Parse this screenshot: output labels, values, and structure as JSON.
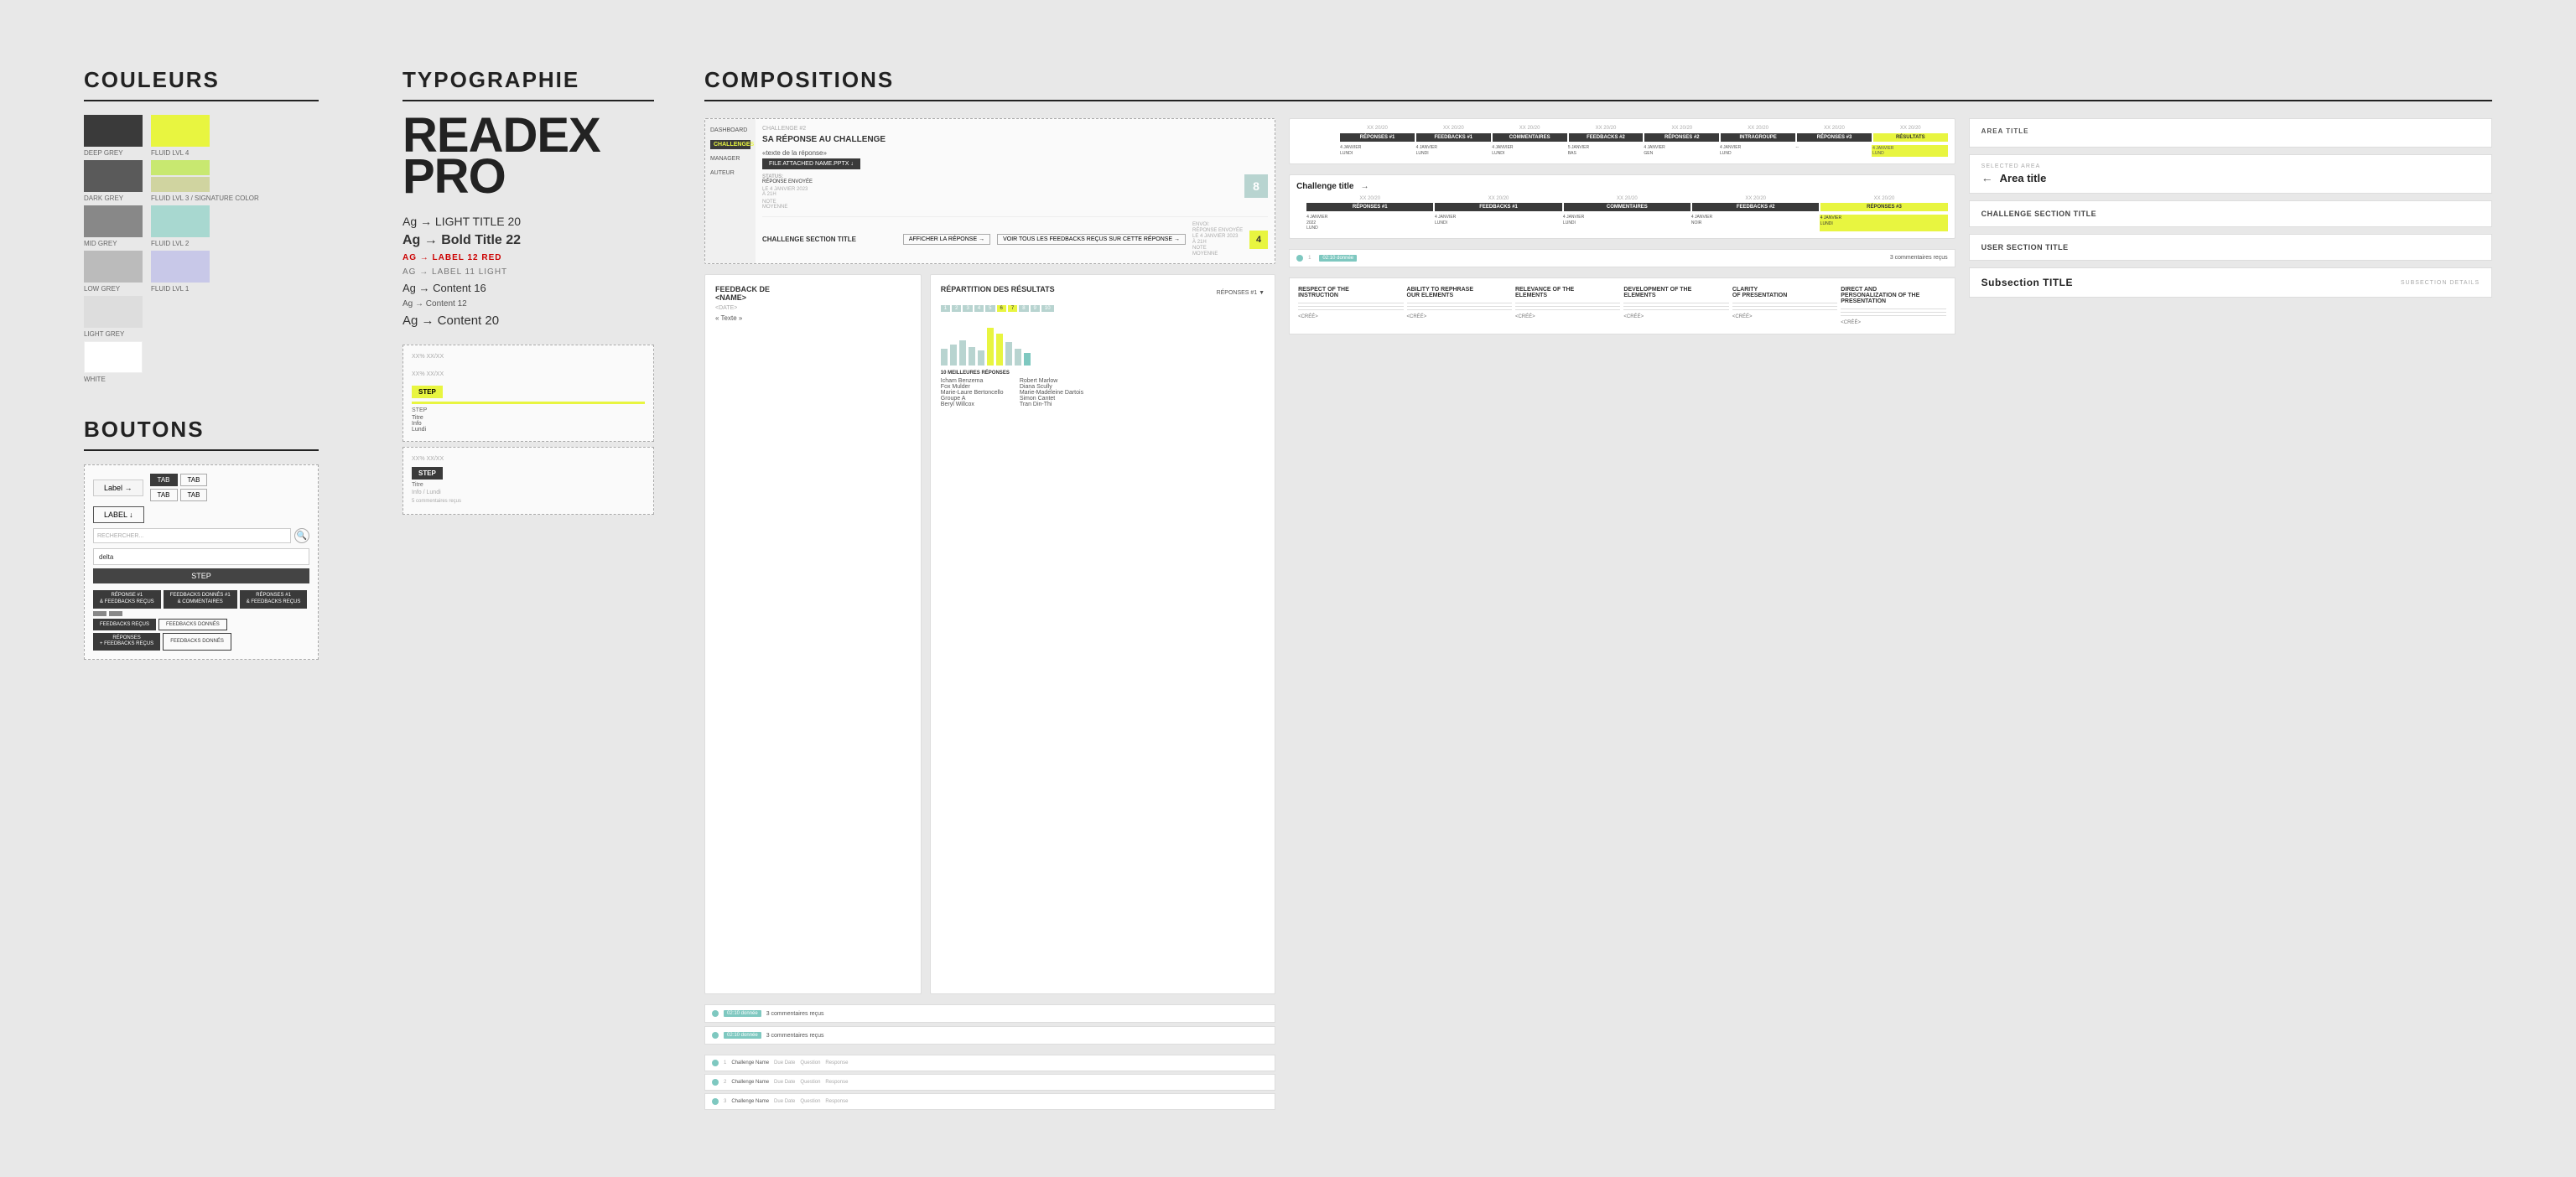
{
  "page": {
    "background": "#e8e8e8"
  },
  "couleurs": {
    "title": "COULEURS",
    "swatches": [
      {
        "label": "DEEP GREY",
        "color": "#3a3a3a",
        "fluid_label": "FLUID LVL 4",
        "fluid_color": "#e8f540"
      },
      {
        "label": "DARK GREY",
        "color": "#666666",
        "fluid_label": "FLUID LVL 3",
        "fluid_color": "#c8e870",
        "fluid_label2": "SIGNATURE COLOR",
        "fluid_color2": "#d4d4aa"
      },
      {
        "label": "MID GREY",
        "color": "#999999",
        "fluid_label": "FLUID LVL 2",
        "fluid_color": "#a8d8d0"
      },
      {
        "label": "LOW GREY",
        "color": "#bbbbbb",
        "fluid_label": "FLUID LVL 1",
        "fluid_color": "#c8c8e8"
      },
      {
        "label": "LIGHT GREY",
        "color": "#dddddd",
        "fluid_label": "",
        "fluid_color": ""
      },
      {
        "label": "WHITE",
        "color": "#ffffff",
        "fluid_label": "",
        "fluid_color": ""
      }
    ]
  },
  "typographie": {
    "title": "TYPOGRAPHIE",
    "logo_lines": [
      "READEX",
      "PRO"
    ],
    "entries": [
      {
        "text": "Ag → LIGHT TITLE 20",
        "style": "light"
      },
      {
        "text": "Ag → Bold Title 22",
        "style": "bold"
      },
      {
        "text": "AG → LABEL 12 RED",
        "style": "label_red"
      },
      {
        "text": "AG → LABEL 11 LIGHT",
        "style": "label_light"
      },
      {
        "text": "Ag → Content 16",
        "style": "content16"
      },
      {
        "text": "Ag → Content 12",
        "style": "content12"
      },
      {
        "text": "Ag → Content 20",
        "style": "content20"
      }
    ]
  },
  "boutons": {
    "title": "BOUTONS",
    "label_arrow": "Label →",
    "label_down": "LABEL ↓",
    "tab1": "TAB",
    "tab2": "TAB",
    "tab3": "TAB",
    "tab4": "TAB",
    "rechercher": "RECHERCHER...",
    "delta": "delta",
    "step": "STEP",
    "reponse_feedbacks": "RÉPONSE #1\n& FEEDBACKS REÇUS",
    "feedbacks_donnes": "FEEDBACKS DONNÉS #1\n& COMMENTAIRES",
    "reponses": "RÉPONSES #1\n& FEEDBACKS REÇUS",
    "feedbacks_recus": "FEEDBACKS REÇUS",
    "feedbacks_donnes2": "FEEDBACKS DONNÉS",
    "reponses_feedbacks2": "RÉPONSES\n+ FEEDBACKS REÇUS",
    "feedbacks_donnes3": "FEEDBACKS DONNÉS"
  },
  "compositions": {
    "title": "COMPOSITIONS",
    "challenge_card": {
      "challenge_num": "CHALLENGE #2",
      "title": "SA RÉPONSE AU CHALLENGE",
      "response_label": "«texte de la réponse»",
      "file_btn": "FILE ATTACHED NAME.PPTX ↓",
      "status_label": "STATUS:",
      "status_value": "RÉPONSE ENVOYÉE",
      "date_label": "LE 4 JANVIER 2023\nÀ 21H",
      "note_label": "NOTE\nMOYENNE",
      "note_value": "8",
      "section_title": "CHALLENGE SECTION TITLE",
      "voir_btn": "VOIR TOUS LES FEEDBACKS\nREÇUS SUR CETTE RÉPONSE →",
      "afficher_btn": "AFFICHER LA RÉPONSE →",
      "envoi_label": "ENVOI:\nRÉPONSE ENVOYÉE",
      "date2": "LE 4 JANVIER 2023\nÀ 21H",
      "note2_label": "NOTE\nMOYENNE",
      "note2_value": "4",
      "nav_items": [
        "DASHBOARD",
        "CHALLENGES",
        "MANAGER",
        "AUTEUR"
      ]
    },
    "feedback_card": {
      "title": "FEEDBACK DE\n<NAME>",
      "date": "<DATE>",
      "text": "« Texte »",
      "results_title": "RÉPARTITION DES RÉSULTATS",
      "reponses_label": "RÉPONSES #1 ▼",
      "top_label": "10 MEILLEURES RÉPONSES",
      "names_left": [
        "Icham Benzema",
        "Fox Mulder",
        "Marie-Laure Bertoncello",
        "Groupe A",
        "Beryl Willcox"
      ],
      "names_right": [
        "Robert Marlow",
        "Diana Scully",
        "Marie-Madeleine Dartois",
        "Simon Cantet",
        "Tran Din-Thi"
      ],
      "bar_numbers": [
        "1",
        "2",
        "3",
        "4",
        "5",
        "6",
        "7",
        "8",
        "9",
        "10"
      ],
      "bar_heights": [
        20,
        25,
        30,
        35,
        40,
        45,
        35,
        30,
        25,
        20
      ]
    },
    "score_table": {
      "cols": [
        "XX 20/20",
        "XX 20/20",
        "XX 20/20",
        "XX 20/20",
        "XX 20/20",
        "XX 20/20",
        "XX 20/20",
        "XX 20/20"
      ],
      "col_labels": [
        "RÉPONSES #1",
        "FEEDBACKS #1",
        "COMMENTAIRES",
        "FEEDBACKS #2",
        "RÉPONSES #2",
        "INTRAGROUPE",
        "RÉPONSES #3",
        "RÉSULTATS"
      ],
      "rows": [
        {
          "date": "4 JANVIER 2022\nLUND",
          "cells": [
            "4 JANVIER\nLUNDI",
            "4 JANVIER\nLUNDI",
            "4 JANVIER\nLUNDI",
            "5 JANVIER\nBAS",
            "4 JANVIER\nGÉN",
            "4 JANVIER\nLUND"
          ]
        }
      ]
    },
    "challenge_score": {
      "title": "Challenge title",
      "arrow": "→",
      "cols": [
        "XX 20/20",
        "XX 20/20",
        "XX 20/20",
        "XX 20/20",
        "XX 20/20"
      ],
      "col_labels": [
        "RÉPONSES #1",
        "FEEDBACKS #1",
        "COMMENTAIRES",
        "FEEDBACKS #2",
        "RÉPONSES #3"
      ],
      "rows": [
        {
          "date": "4 JANVIER 2022\nLUND",
          "cells": [
            "4 JANVIER\nLUNDI",
            "4 JANVIER\nLUNDI",
            "4 JANVIER\nLUNDI",
            "4 JANVIER\nNOIR"
          ]
        }
      ]
    },
    "area_panel": {
      "area_title": "AREA TITLE",
      "selected_label": "SELECTED AREA",
      "selected_title": "Area title",
      "challenge_section": "CHALLENGE SECTION TITLE",
      "user_section": "USER SECTION TITLE",
      "subsection_title": "Subsection TITLE",
      "subsection_details": "SUBSECTION DETAILS"
    },
    "small_cards": [
      {
        "dot_color": "#7ec8c0",
        "tag": "02:10 donnée",
        "count": "3 commentaires reçus"
      },
      {
        "dot_color": "#7ec8c0",
        "tag": "02:10 donnée",
        "count": "3 commentaires reçus"
      },
      {
        "dot_color": "#7ec8c0",
        "tag": "02:10 donnée",
        "count": ""
      }
    ],
    "step_component": {
      "xx_label": "XX%   XX/XX",
      "step_label": "STEP",
      "sub_label": "STEP",
      "info1": "Titre",
      "info2": "Info",
      "info3": "Lundi"
    },
    "rubric_card": {
      "cols": [
        {
          "title": "RESPECT OF THE\nINSTRUCTION"
        },
        {
          "title": "ABILITY TO REPHRASE\nOUR ELEMENTS"
        },
        {
          "title": "RELEVANCE OF THE\nELEMENTS"
        },
        {
          "title": "DEVELOPMENT OF THE\nELEMENTS"
        },
        {
          "title": "CLARITY\nOF PRESENTATION"
        },
        {
          "title": "DIRECT AND\nPERSONALIZATION OF THE\nPRESENTATION"
        }
      ],
      "value": "<CRÉÉ>"
    }
  }
}
